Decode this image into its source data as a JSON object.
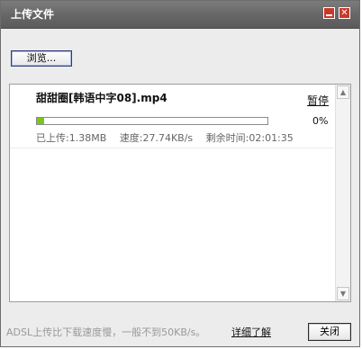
{
  "window": {
    "title": "上传文件",
    "minimize_symbol": "",
    "close_symbol": "✕"
  },
  "toolbar": {
    "browse_label": "浏览..."
  },
  "uploads": [
    {
      "file_name": "甜甜圈[韩语中字08].mp4",
      "action_label": "暂停",
      "progress_percent": 3,
      "percent_text": "0%",
      "uploaded": "已上传:1.38MB",
      "speed": "速度:27.74KB/s",
      "remaining": "剩余时间:02:01:35"
    }
  ],
  "footer": {
    "note": "ADSL上传比下载速度慢，一般不到50KB/s。",
    "detail_link": "详细了解",
    "close_label": "关闭"
  },
  "scrollbar": {
    "up_icon": "▲",
    "down_icon": "▼"
  },
  "colors": {
    "titlebar": "#666666",
    "window_button": "#c63a2b",
    "progress_fill": "#7fc41a"
  }
}
